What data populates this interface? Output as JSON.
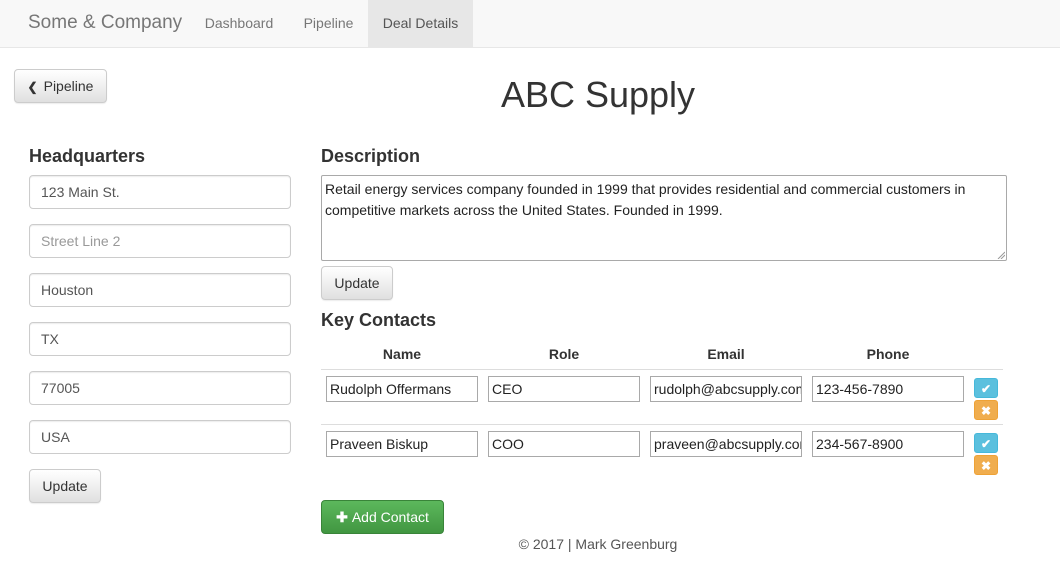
{
  "nav": {
    "brand": "Some & Company",
    "links": [
      {
        "label": "Dashboard"
      },
      {
        "label": "Pipeline"
      },
      {
        "label": "Deal Details",
        "active": true
      }
    ]
  },
  "back_button": {
    "label": "Pipeline",
    "icon": "chevron-left-icon"
  },
  "deal": {
    "title": "ABC Supply"
  },
  "headquarters": {
    "heading": "Headquarters",
    "fields": [
      {
        "value": "123 Main St.",
        "placeholder": ""
      },
      {
        "value": "",
        "placeholder": "Street Line 2"
      },
      {
        "value": "Houston",
        "placeholder": ""
      },
      {
        "value": "TX",
        "placeholder": ""
      },
      {
        "value": "77005",
        "placeholder": ""
      },
      {
        "value": "USA",
        "placeholder": ""
      }
    ],
    "update_label": "Update"
  },
  "description": {
    "heading": "Description",
    "text": "Retail energy services company founded in 1999 that provides residential and commercial customers in competitive markets across the United States. Founded in 1999.",
    "update_label": "Update"
  },
  "contacts": {
    "heading": "Key Contacts",
    "columns": [
      "Name",
      "Role",
      "Email",
      "Phone"
    ],
    "rows": [
      {
        "name": "Rudolph Offermans",
        "role": "CEO",
        "email": "rudolph@abcsupply.com",
        "phone": "123-456-7890"
      },
      {
        "name": "Praveen Biskup",
        "role": "COO",
        "email": "praveen@abcsupply.com",
        "phone": "234-567-8900"
      }
    ],
    "add_label": "Add Contact"
  },
  "footer": {
    "text": "© 2017 | Mark Greenburg"
  },
  "colors": {
    "info": "#5bc0de",
    "warning": "#f0ad4e",
    "success": "#5cb85c"
  }
}
